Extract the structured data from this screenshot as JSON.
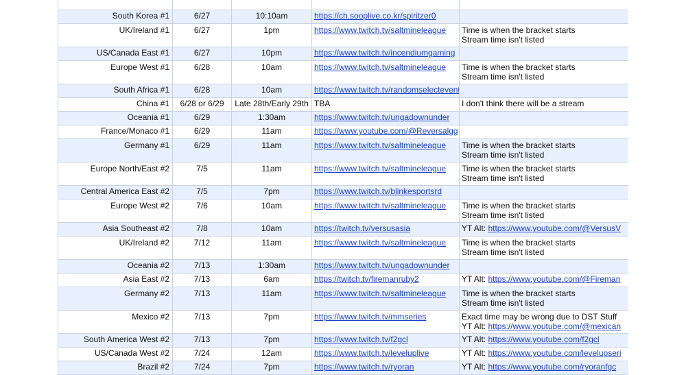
{
  "rows": [
    {
      "region": "",
      "date": "",
      "time": "",
      "link": "",
      "is_link": false,
      "notes": []
    },
    {
      "region": "South Korea #1",
      "date": "6/27",
      "time": "10:10am",
      "link": "https://ch.sooplive.co.kr/spiritzer0",
      "is_link": true,
      "notes": []
    },
    {
      "region": "UK/Ireland #1",
      "date": "6/27",
      "time": "1pm",
      "link": "https://www.twitch.tv/saltmineleague",
      "is_link": true,
      "notes": [
        "Time is when the bracket starts",
        "Stream time isn't listed"
      ]
    },
    {
      "region": "US/Canada East #1",
      "date": "6/27",
      "time": "10pm",
      "link": "https://www.twitch.tv/incendiumgaming",
      "is_link": true,
      "notes": []
    },
    {
      "region": "Europe West #1",
      "date": "6/28",
      "time": "10am",
      "link": "https://www.twitch.tv/saltmineleague",
      "is_link": true,
      "notes": [
        "Time is when the bracket starts",
        "Stream time isn't listed"
      ]
    },
    {
      "region": "South Africa #1",
      "date": "6/28",
      "time": "10am",
      "link": "https://www.twitch.tv/randomselectevents",
      "is_link": true,
      "notes": []
    },
    {
      "region": "China #1",
      "date": "6/28 or 6/29",
      "time": "Late 28th/Early 29th",
      "link": "TBA",
      "is_link": false,
      "notes": [
        "I don't think there will be a stream"
      ]
    },
    {
      "region": "Oceania #1",
      "date": "6/29",
      "time": "1:30am",
      "link": "https://www.twitch.tv/ungadownunder",
      "is_link": true,
      "notes": []
    },
    {
      "region": "France/Monaco #1",
      "date": "6/29",
      "time": "11am",
      "link": "https://www.youtube.com/@Reversalgg",
      "is_link": true,
      "notes": []
    },
    {
      "region": "Germany #1",
      "date": "6/29",
      "time": "11am",
      "link": "https://www.twitch.tv/saltmineleague",
      "is_link": true,
      "notes": [
        "Time is when the bracket starts",
        "Stream time isn't listed"
      ]
    },
    {
      "region": "Europe North/East #2",
      "date": "7/5",
      "time": "11am",
      "link": "https://www.twitch.tv/saltmineleague",
      "is_link": true,
      "notes": [
        "Time is when the bracket starts",
        "Stream time isn't listed"
      ]
    },
    {
      "region": "Central America East #2",
      "date": "7/5",
      "time": "7pm",
      "link": "https://www.twitch.tv/blinkesportsrd",
      "is_link": true,
      "notes": []
    },
    {
      "region": "Europe West #2",
      "date": "7/6",
      "time": "10am",
      "link": "https://www.twitch.tv/saltmineleague",
      "is_link": true,
      "notes": [
        "Time is when the bracket starts",
        "Stream time isn't listed"
      ]
    },
    {
      "region": "Asia Southeast #2",
      "date": "7/8",
      "time": "10am",
      "link": "https://twitch.tv/versusasia",
      "is_link": true,
      "notes": [
        {
          "prefix": "YT Alt: ",
          "link": "https://www.youtube.com/@VersusV"
        }
      ]
    },
    {
      "region": "UK/Ireland #2",
      "date": "7/12",
      "time": "11am",
      "link": "https://www.twitch.tv/saltmineleague",
      "is_link": true,
      "notes": [
        "Time is when the bracket starts",
        "Stream time isn't listed"
      ]
    },
    {
      "region": "Oceania #2",
      "date": "7/13",
      "time": "1:30am",
      "link": "https://www.twitch.tv/ungadownunder",
      "is_link": true,
      "notes": []
    },
    {
      "region": "Asia East #2",
      "date": "7/13",
      "time": "6am",
      "link": "https://twitch.tv/firemanruby2",
      "is_link": true,
      "notes": [
        {
          "prefix": "YT Alt: ",
          "link": "https://www.youtube.com/@Fireman"
        }
      ]
    },
    {
      "region": "Germany #2",
      "date": "7/13",
      "time": "11am",
      "link": "https://www.twitch.tv/saltmineleague",
      "is_link": true,
      "notes": [
        "Time is when the bracket starts",
        "Stream time isn't listed"
      ]
    },
    {
      "region": "Mexico #2",
      "date": "7/13",
      "time": "7pm",
      "link": "https://www.twitch.tv/mmseries",
      "is_link": true,
      "notes": [
        "Exact time may be wrong due to DST Stuff",
        {
          "prefix": "YT Alt: ",
          "link": "https://www.youtube.com/@mexican"
        }
      ]
    },
    {
      "region": "South America West #2",
      "date": "7/13",
      "time": "7pm",
      "link": "https://www.twitch.tv/f2gcl",
      "is_link": true,
      "notes": [
        {
          "prefix": "YT Alt: ",
          "link": "https://www.youtube.com/f2gcl"
        }
      ]
    },
    {
      "region": "US/Canada West #2",
      "date": "7/24",
      "time": "12am",
      "link": "https://www.twitch.tv/leveluplive",
      "is_link": true,
      "notes": [
        {
          "prefix": "YT Alt: ",
          "link": "https://www.youtube.com/levelupseri"
        }
      ]
    },
    {
      "region": "Brazil #2",
      "date": "7/24",
      "time": "7pm",
      "link": "https://www.twitch.tv/ryoran",
      "is_link": true,
      "notes": [
        {
          "prefix": "YT Alt: ",
          "link": "https://www.youtube.com/ryoranfgc"
        }
      ]
    }
  ],
  "colors": {
    "shade": "#e8f0fd",
    "border": "#c9d3e4",
    "link": "#1a3fc8"
  }
}
